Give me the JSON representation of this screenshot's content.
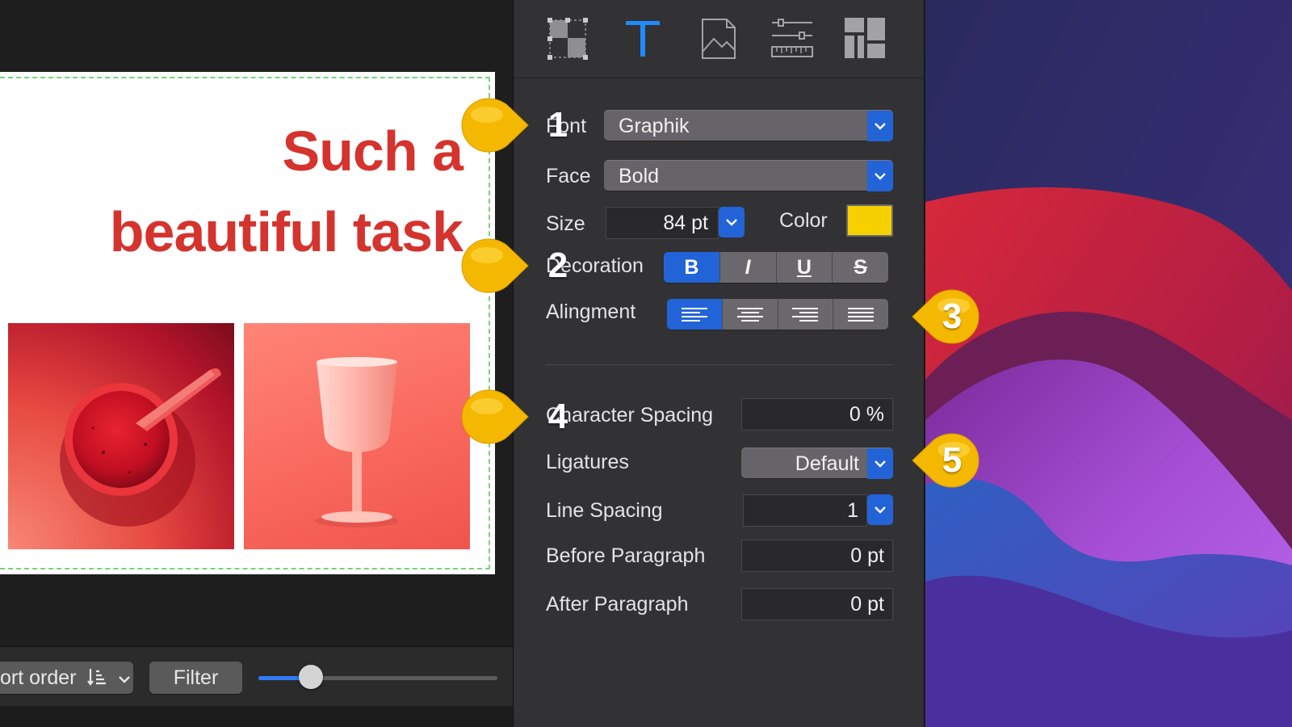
{
  "canvas": {
    "headline_line1": "Such a",
    "headline_line2": "beautiful task",
    "headline_color": "#d5332e"
  },
  "toolbar": {
    "sort_label": "ort order",
    "sort_icon": "sort-order-icon",
    "filter_label": "Filter",
    "zoom_slider_value": 0.22
  },
  "inspector": {
    "tabs": [
      {
        "name": "layout-tab",
        "icon": "layout-grid-icon",
        "active": false
      },
      {
        "name": "text-tab",
        "icon": "text-t-icon",
        "active": true
      },
      {
        "name": "image-tab",
        "icon": "image-icon",
        "active": false
      },
      {
        "name": "ruler-tab",
        "icon": "ruler-sliders-icon",
        "active": false
      },
      {
        "name": "arrange-tab",
        "icon": "arrange-blocks-icon",
        "active": false
      }
    ],
    "font": {
      "label": "Font",
      "value": "Graphik"
    },
    "face": {
      "label": "Face",
      "value": "Bold"
    },
    "size": {
      "label": "Size",
      "value": "84 pt"
    },
    "color": {
      "label": "Color",
      "value": "#f7d000"
    },
    "decoration": {
      "label": "Decoration",
      "buttons": [
        {
          "name": "bold",
          "glyph": "B",
          "active": true
        },
        {
          "name": "italic",
          "glyph": "I",
          "active": false
        },
        {
          "name": "underline",
          "glyph": "U",
          "active": false
        },
        {
          "name": "strikethrough",
          "glyph": "S",
          "active": false
        }
      ]
    },
    "alignment": {
      "label": "Alingment",
      "options": [
        "left",
        "center",
        "right",
        "justify"
      ],
      "selected": "left"
    },
    "character_spacing": {
      "label": "Character Spacing",
      "value": "0 %"
    },
    "ligatures": {
      "label": "Ligatures",
      "value": "Default"
    },
    "line_spacing": {
      "label": "Line Spacing",
      "value": "1"
    },
    "before_paragraph": {
      "label": "Before Paragraph",
      "value": "0 pt"
    },
    "after_paragraph": {
      "label": "After Paragraph",
      "value": "0 pt"
    }
  },
  "callouts": [
    "1",
    "2",
    "3",
    "4",
    "5"
  ],
  "colors": {
    "accent": "#2264d8",
    "callout_yellow": "#f5b800",
    "inspector_bg": "#323133"
  }
}
